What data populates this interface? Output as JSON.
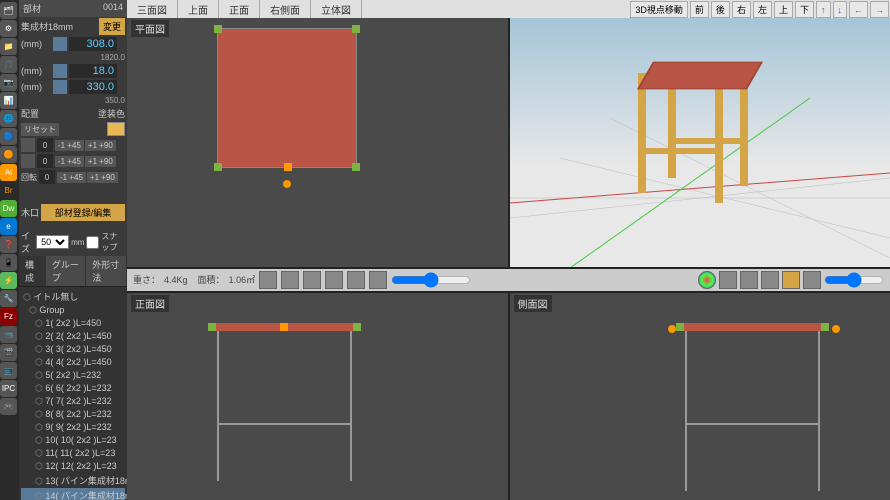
{
  "header": {
    "title": "部材",
    "id": "0014"
  },
  "material": {
    "name": "集成材18mm",
    "change_btn": "変更"
  },
  "dims": {
    "w_label": "(mm)",
    "w_val": "308.0",
    "w_sub": "1820.0",
    "h_label": "(mm)",
    "h_val": "18.0",
    "d_label": "(mm)",
    "d_val": "330.0",
    "d_sub": "350.0"
  },
  "layout_label": "配置",
  "paint_label": "塗装色",
  "reset_btn": "リセット",
  "spinners": [
    "0",
    "0",
    "0"
  ],
  "spin_labels": [
    "-1 +45",
    "+1 +90"
  ],
  "rotate_label": "回転",
  "wood_label": "木口",
  "register_btn": "部材登録/編集",
  "size_label": "イズ",
  "size_val": "50",
  "size_unit": "mm",
  "snap_label": "スナップ",
  "tabs": [
    "構成",
    "グループ",
    "外形寸法"
  ],
  "tree_title": "イトル無し",
  "tree_group": "Group",
  "tree_items": [
    "1( 2x2 )L=450",
    "2( 2( 2x2 )L=450",
    "3( 3( 2x2 )L=450",
    "4( 4( 2x2 )L=450",
    "5( 2x2 )L=232",
    "6( 6( 2x2 )L=232",
    "7( 7( 2x2 )L=232",
    "8( 8( 2x2 )L=232",
    "9( 9( 2x2 )L=232",
    "10( 10( 2x2 )L=23",
    "11( 11( 2x2 )L=23",
    "12( 12( 2x2 )L=23",
    "13( パイン集成材18m",
    "14( パイン集成材18m"
  ],
  "view_tabs": [
    "三面図",
    "上面",
    "正面",
    "右側面",
    "立体図"
  ],
  "vp_labels": {
    "top": "平面図",
    "front": "正面図",
    "side": "側面図"
  },
  "nav_3d": "3D視点移動",
  "nav_btns": [
    "前",
    "後",
    "右",
    "左",
    "上",
    "下"
  ],
  "arrows": [
    "↑",
    "↓",
    "←",
    "→"
  ],
  "stats": {
    "weight_label": "重さ：",
    "weight": "4.4Kg",
    "area_label": "面積：",
    "area": "1.06㎡"
  },
  "dock_icons": [
    "🗂",
    "⚙",
    "📁",
    "🎵",
    "📷",
    "📊",
    "🌐",
    "🔵",
    "🟠",
    "Ai",
    "Br",
    "Dw",
    "e",
    "❓",
    "📱",
    "⚡",
    "🔧",
    "Fz",
    "📹",
    "🎬",
    "📺",
    "IPC",
    "🎮"
  ]
}
